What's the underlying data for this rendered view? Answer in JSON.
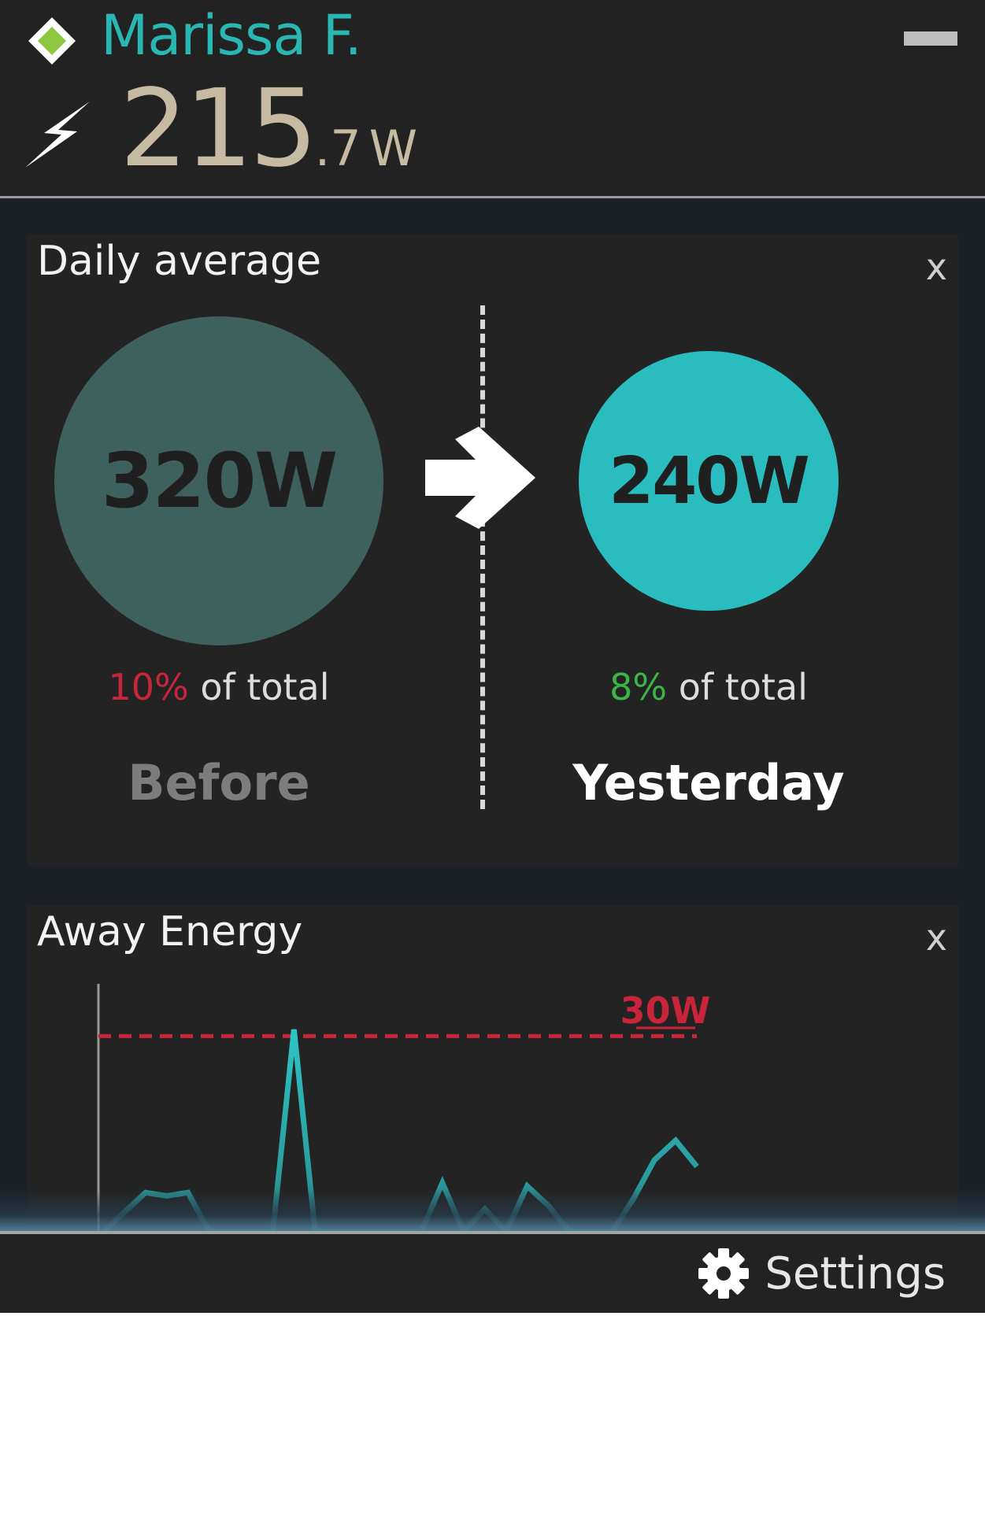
{
  "header": {
    "user_name": "Marissa F.",
    "power_whole": "215",
    "power_decimal": ".7",
    "power_unit": "W",
    "status_icon": "diamond-icon",
    "status_color": "#8dc63f"
  },
  "daily_average": {
    "title": "Daily average",
    "close_label": "x",
    "before": {
      "value": "320W",
      "percent": "10%",
      "percent_suffix": " of total",
      "label": "Before"
    },
    "yesterday": {
      "value": "240W",
      "percent": "8%",
      "percent_suffix": " of total",
      "label": "Yesterday"
    }
  },
  "away_energy": {
    "title": "Away Energy",
    "close_label": "x",
    "threshold_label": "30W"
  },
  "footer": {
    "settings_label": "Settings"
  },
  "colors": {
    "accent": "#2ab7b4",
    "power_text": "#c6bba2",
    "threshold": "#c8243a",
    "positive": "#3cb548"
  },
  "chart_data": {
    "type": "line",
    "title": "Away Energy",
    "threshold": {
      "value": 30,
      "label": "30W"
    },
    "ylim": [
      0,
      38
    ],
    "x": [
      0,
      1,
      2,
      3,
      4,
      5,
      6,
      7,
      8,
      9,
      10,
      11,
      12,
      13,
      14,
      15,
      16,
      17,
      18,
      19,
      20,
      21,
      22,
      23,
      24,
      25,
      26,
      27,
      28
    ],
    "series": [
      {
        "values": [
          0,
          3,
          6,
          5.5,
          6,
          0,
          0,
          0,
          0,
          31,
          0,
          0,
          0,
          0,
          0,
          0,
          7.5,
          0,
          3.5,
          0,
          7,
          4,
          0,
          0,
          0,
          5,
          11,
          14,
          10
        ]
      }
    ]
  }
}
